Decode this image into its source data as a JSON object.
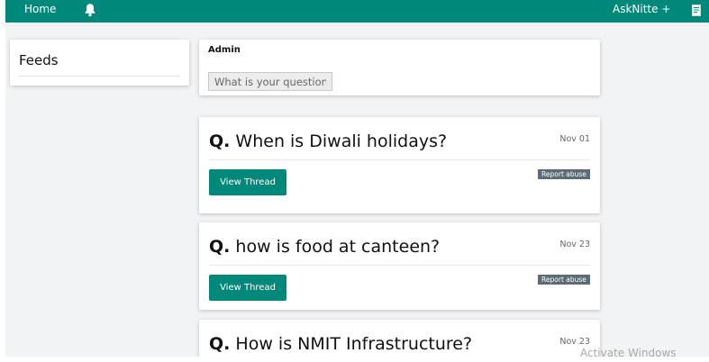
{
  "navbar": {
    "home_label": "Home",
    "ask_label": "AskNitte +",
    "accent_color": "#00897b",
    "icons": [
      "bell-icon",
      "document-icon"
    ]
  },
  "sidebar": {
    "feeds_title": "Feeds"
  },
  "ask_box": {
    "user_name": "Admin",
    "placeholder": "What is your question?"
  },
  "questions": [
    {
      "prefix": "Q.",
      "text": "When is Diwali holidays?",
      "date": "Nov 01",
      "view_label": "View Thread",
      "report_label": "Report abuse"
    },
    {
      "prefix": "Q.",
      "text": "how is food at canteen?",
      "date": "Nov 23",
      "view_label": "View Thread",
      "report_label": "Report abuse"
    },
    {
      "prefix": "Q.",
      "text": "How is NMIT Infrastructure?",
      "date": "Nov 23"
    }
  ],
  "os_watermark": "Activate Windows"
}
